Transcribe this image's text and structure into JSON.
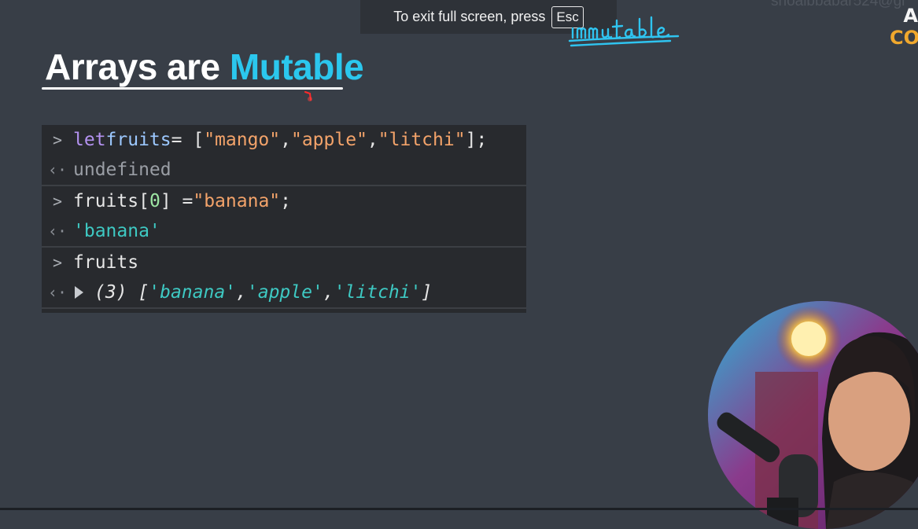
{
  "fullscreen_banner": {
    "text": "To exit full screen, press",
    "key": "Esc"
  },
  "watermark": "shoaibbabar524@gi",
  "corner_logo": {
    "top": "A",
    "bottom": "CO"
  },
  "handwriting": "immutable",
  "slide": {
    "title_plain": "Arrays are ",
    "title_accent": "Mutable"
  },
  "console": {
    "entries": [
      {
        "input_tokens": [
          "let",
          " ",
          "fruits",
          " = [",
          "\"mango\"",
          ", ",
          "\"apple\"",
          ", ",
          "\"litchi\"",
          "];"
        ],
        "output": "undefined"
      },
      {
        "input_tokens": [
          "fruits",
          "[",
          "0",
          "] = ",
          "\"banana\"",
          ";"
        ],
        "output": "'banana'"
      },
      {
        "input_tokens": [
          "fruits"
        ],
        "output_tokens": [
          "(3) [",
          "'banana'",
          ", ",
          "'apple'",
          ", ",
          "'litchi'",
          "]"
        ]
      }
    ]
  },
  "colors": {
    "background": "#383e47",
    "accent": "#2bc7ee",
    "console_bg": "#282a2e",
    "string": "#f3a36a",
    "result": "#3ec9c3"
  }
}
